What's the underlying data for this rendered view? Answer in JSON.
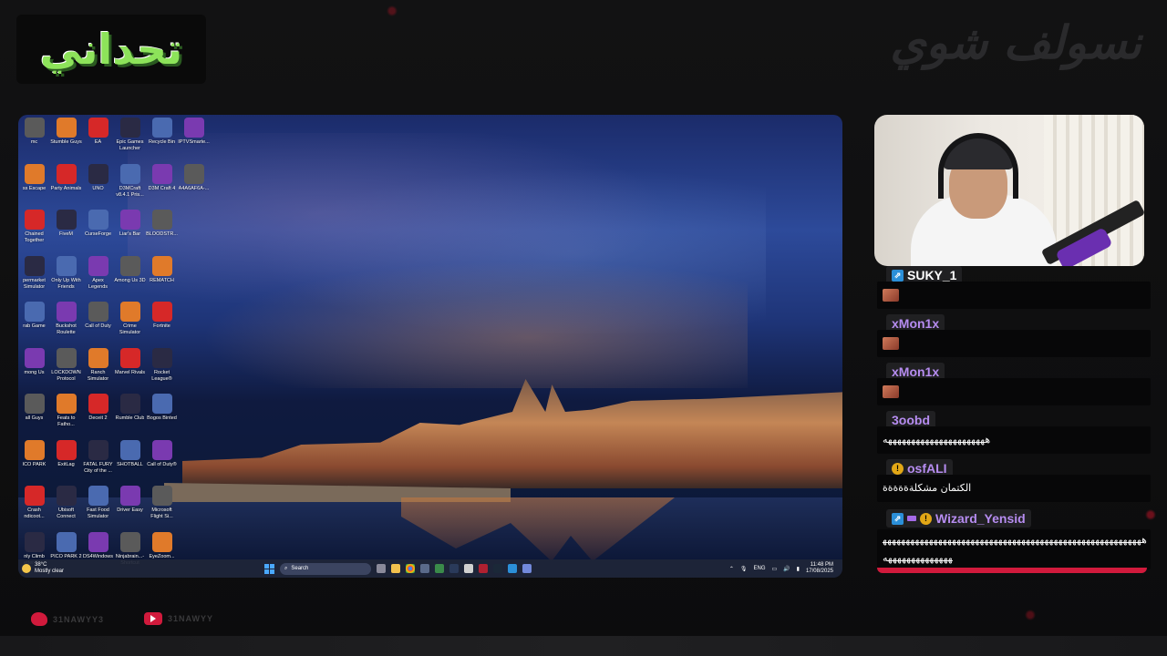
{
  "overlay": {
    "logo_text": "تحداني",
    "title": "نسولف شوي",
    "social": [
      {
        "platform": "twitter",
        "handle": "31NAWYY3"
      },
      {
        "platform": "youtube",
        "handle": "31NAWYY"
      }
    ],
    "accent_color": "#d11a3c"
  },
  "desktop": {
    "icons": [
      [
        "mc",
        "Stumble Guys",
        "EA",
        "Epic Games Launcher",
        "Recycle Bin",
        "IPTVSmarte..."
      ],
      [
        "ss Escape",
        "Party Animals",
        "UNO",
        "D3MCraft v8.4.1 Pris...",
        "D3M Craft 4",
        "A4A6AF6A-..."
      ],
      [
        "Chained Together",
        "FiveM",
        "CurseForge",
        "Liar's Bar",
        "BLOODSTR...",
        ""
      ],
      [
        "permarket Simulator",
        "Only Up With Friends",
        "Apex Legends",
        "Among Us 3D",
        "REMATCH",
        ""
      ],
      [
        "rab Game",
        "Buckshot Roulette",
        "Call of Duty",
        "Crime Simulator",
        "Fortnite",
        ""
      ],
      [
        "mong Us",
        "LOCKDOWN Protocol",
        "Ranch Simulator",
        "Marvel Rivals",
        "Rocket League®",
        ""
      ],
      [
        "all Guys",
        "Feats to Fatho...",
        "Deceit 2",
        "Rumble Club",
        "Bogos Binted",
        ""
      ],
      [
        "ICO PARK",
        "ExitLag",
        "FATAL FURY City of the ...",
        "SHOTBALL",
        "Call of Duty®",
        ""
      ],
      [
        "Crash ndicoot...",
        "Ubisoft Connect",
        "Fast Food Simulator",
        "Driver Easy",
        "Microsoft Flight Si...",
        ""
      ],
      [
        "nly Climb etter To...",
        "PICO PARK 2",
        "DS4Windows",
        "Ninjabrain...- Shortcut",
        "EyeZoom...",
        ""
      ]
    ],
    "taskbar": {
      "weather_temp": "38°C",
      "weather_desc": "Mostly clear",
      "search_placeholder": "Search",
      "lang": "ENG",
      "time": "11:48 PM",
      "date": "17/08/2025"
    }
  },
  "chat": {
    "messages": [
      {
        "user": "SUKY_1",
        "color": "#ffffff",
        "badges": [
          "prime"
        ],
        "text": ""
      },
      {
        "user": "xMon1x",
        "color": "#b68cf0",
        "badges": [],
        "text": ""
      },
      {
        "user": "xMon1x",
        "color": "#b68cf0",
        "badges": [],
        "text": ""
      },
      {
        "user": "3oobd",
        "color": "#b68cf0",
        "badges": [],
        "text": "ههههههههههههههههههههههه"
      },
      {
        "user": "osfALI",
        "color": "#b68cf0",
        "badges": [
          "coin"
        ],
        "text": "الكتمان مشكلةةةةةة"
      },
      {
        "user": "Wizard_Yensid",
        "color": "#b68cf0",
        "badges": [
          "prime",
          "sub",
          "coin"
        ],
        "text": "هههههههههههههههههههههههههههههههههههههههههههههههههههههههههههههههههههههههه"
      }
    ]
  }
}
